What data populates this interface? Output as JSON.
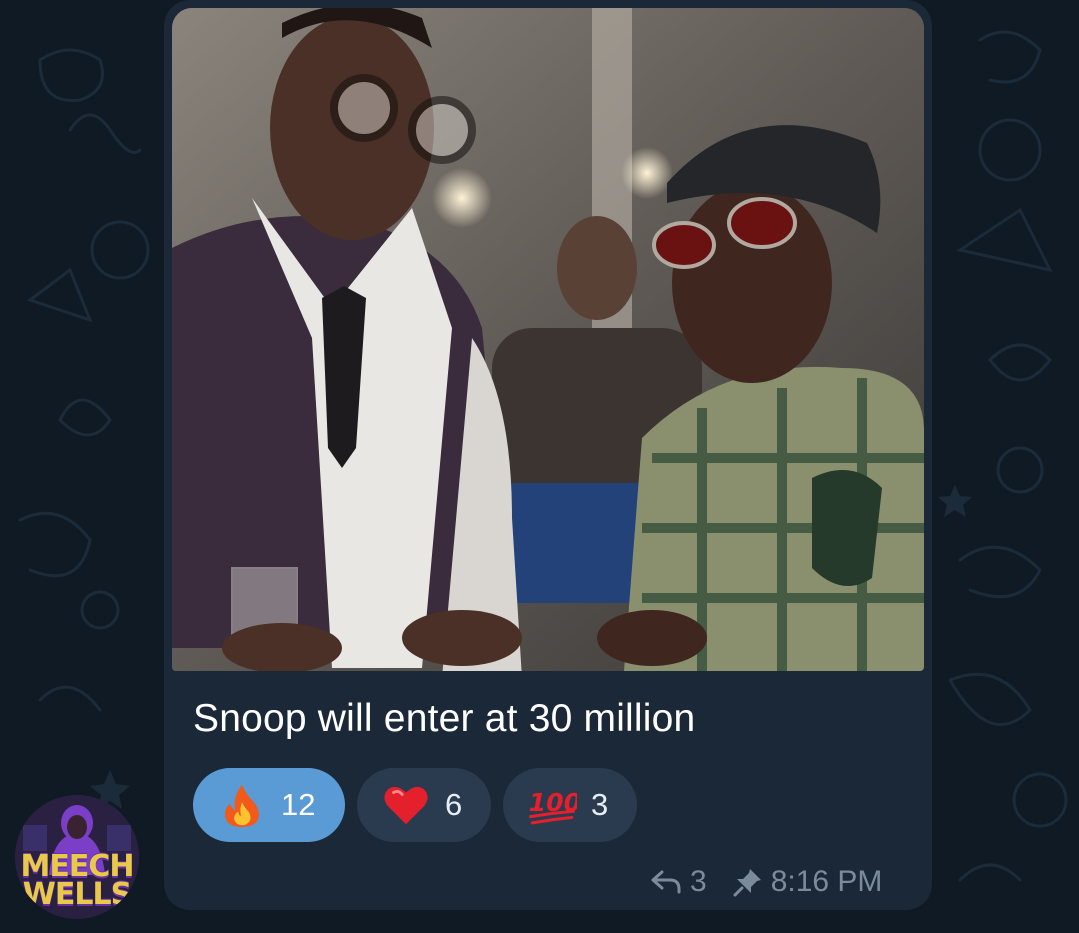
{
  "message": {
    "caption": "Snoop will enter at 30 million",
    "reactions": [
      {
        "emoji": "fire",
        "count": "12",
        "selected": true
      },
      {
        "emoji": "red-heart",
        "count": "6",
        "selected": false
      },
      {
        "emoji": "hundred-points",
        "count": "3",
        "selected": false
      }
    ],
    "replies_count": "3",
    "time": "8:16 PM"
  },
  "sender": {
    "avatar_logo_text": "MEECH WELLS"
  },
  "colors": {
    "background": "#0f1a24",
    "bubble": "#1b2838",
    "reaction_selected": "#5b9bd5",
    "reaction_default": "#2b3b4f",
    "meta_text": "#7b8b9c"
  }
}
